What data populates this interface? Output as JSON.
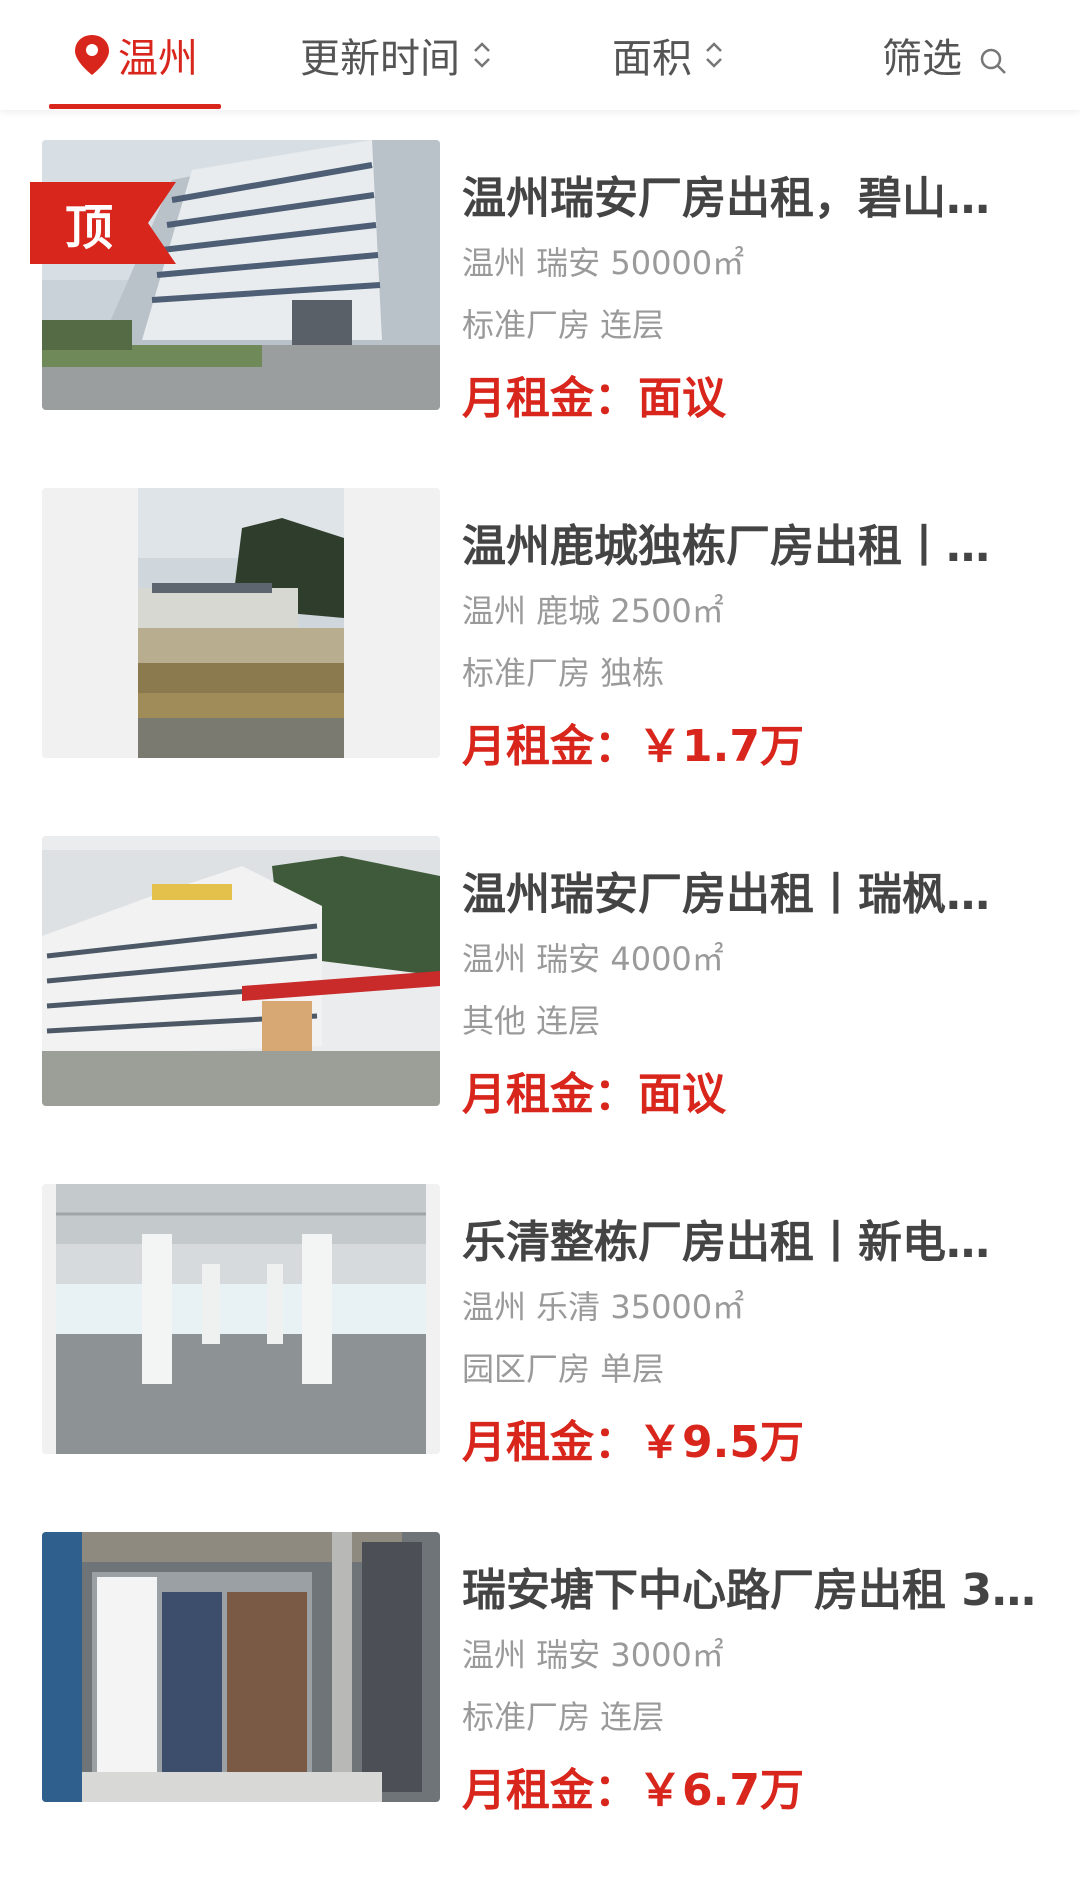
{
  "header": {
    "city": "温州",
    "sort_update_label": "更新时间",
    "sort_area_label": "面积",
    "filter_label": "筛选",
    "accent_color": "#d9261c"
  },
  "listings": [
    {
      "title": "温州瑞安厂房出租，碧山…",
      "location": "温州 瑞安 50000㎡",
      "type": "标准厂房 连层",
      "price": "月租金：面议",
      "badge": "顶",
      "image": "modern-multistory-factory-building"
    },
    {
      "title": "温州鹿城独栋厂房出租丨…",
      "location": "温州 鹿城 2500㎡",
      "type": "标准厂房 独栋",
      "price": "月租金：￥1.7万",
      "image": "single-story-factory-hillside"
    },
    {
      "title": "温州瑞安厂房出租丨瑞枫…",
      "location": "温州 瑞安 4000㎡",
      "type": "其他 连层",
      "price": "月租金：面议",
      "image": "white-building-with-gas-station"
    },
    {
      "title": "乐清整栋厂房出租丨新电…",
      "location": "温州 乐清 35000㎡",
      "type": "园区厂房 单层",
      "price": "月租金：￥9.5万",
      "image": "empty-factory-interior-columns"
    },
    {
      "title": "瑞安塘下中心路厂房出租 3…",
      "location": "温州 瑞安 3000㎡",
      "type": "标准厂房 连层",
      "price": "月租金：￥6.7万",
      "image": "aerial-view-factory-roofs"
    }
  ]
}
